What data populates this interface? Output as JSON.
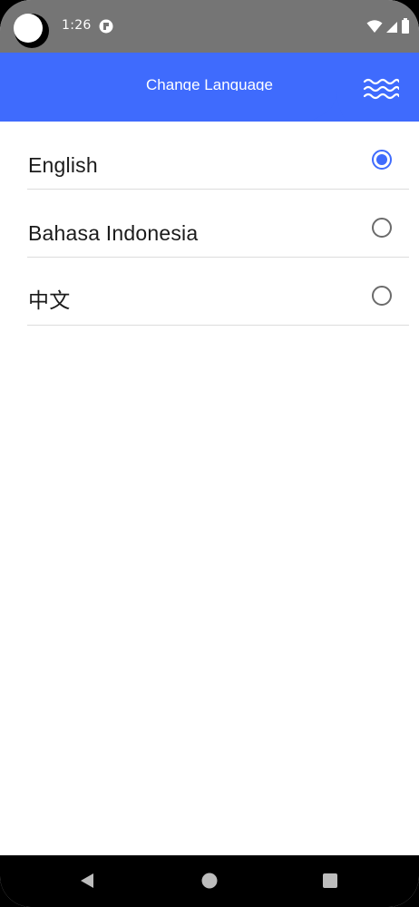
{
  "status_bar": {
    "time": "1:26",
    "icons": [
      "wifi-icon",
      "cellular-signal-icon",
      "battery-icon"
    ],
    "notification_icon": "app-notification-icon"
  },
  "app_bar": {
    "title": "Change Language",
    "menu_icon": "wave-menu-icon",
    "color": "#3f6bfd"
  },
  "languages": [
    {
      "label": "English",
      "selected": true
    },
    {
      "label": "Bahasa Indonesia",
      "selected": false
    },
    {
      "label": "中文",
      "selected": false
    }
  ],
  "nav_bar": {
    "buttons": [
      "back-icon",
      "home-icon",
      "recents-icon"
    ]
  },
  "colors": {
    "accent": "#3f6bfd",
    "radio_off": "#6b6b6b",
    "divider": "#dcdcdc",
    "status_bar": "#757575"
  }
}
